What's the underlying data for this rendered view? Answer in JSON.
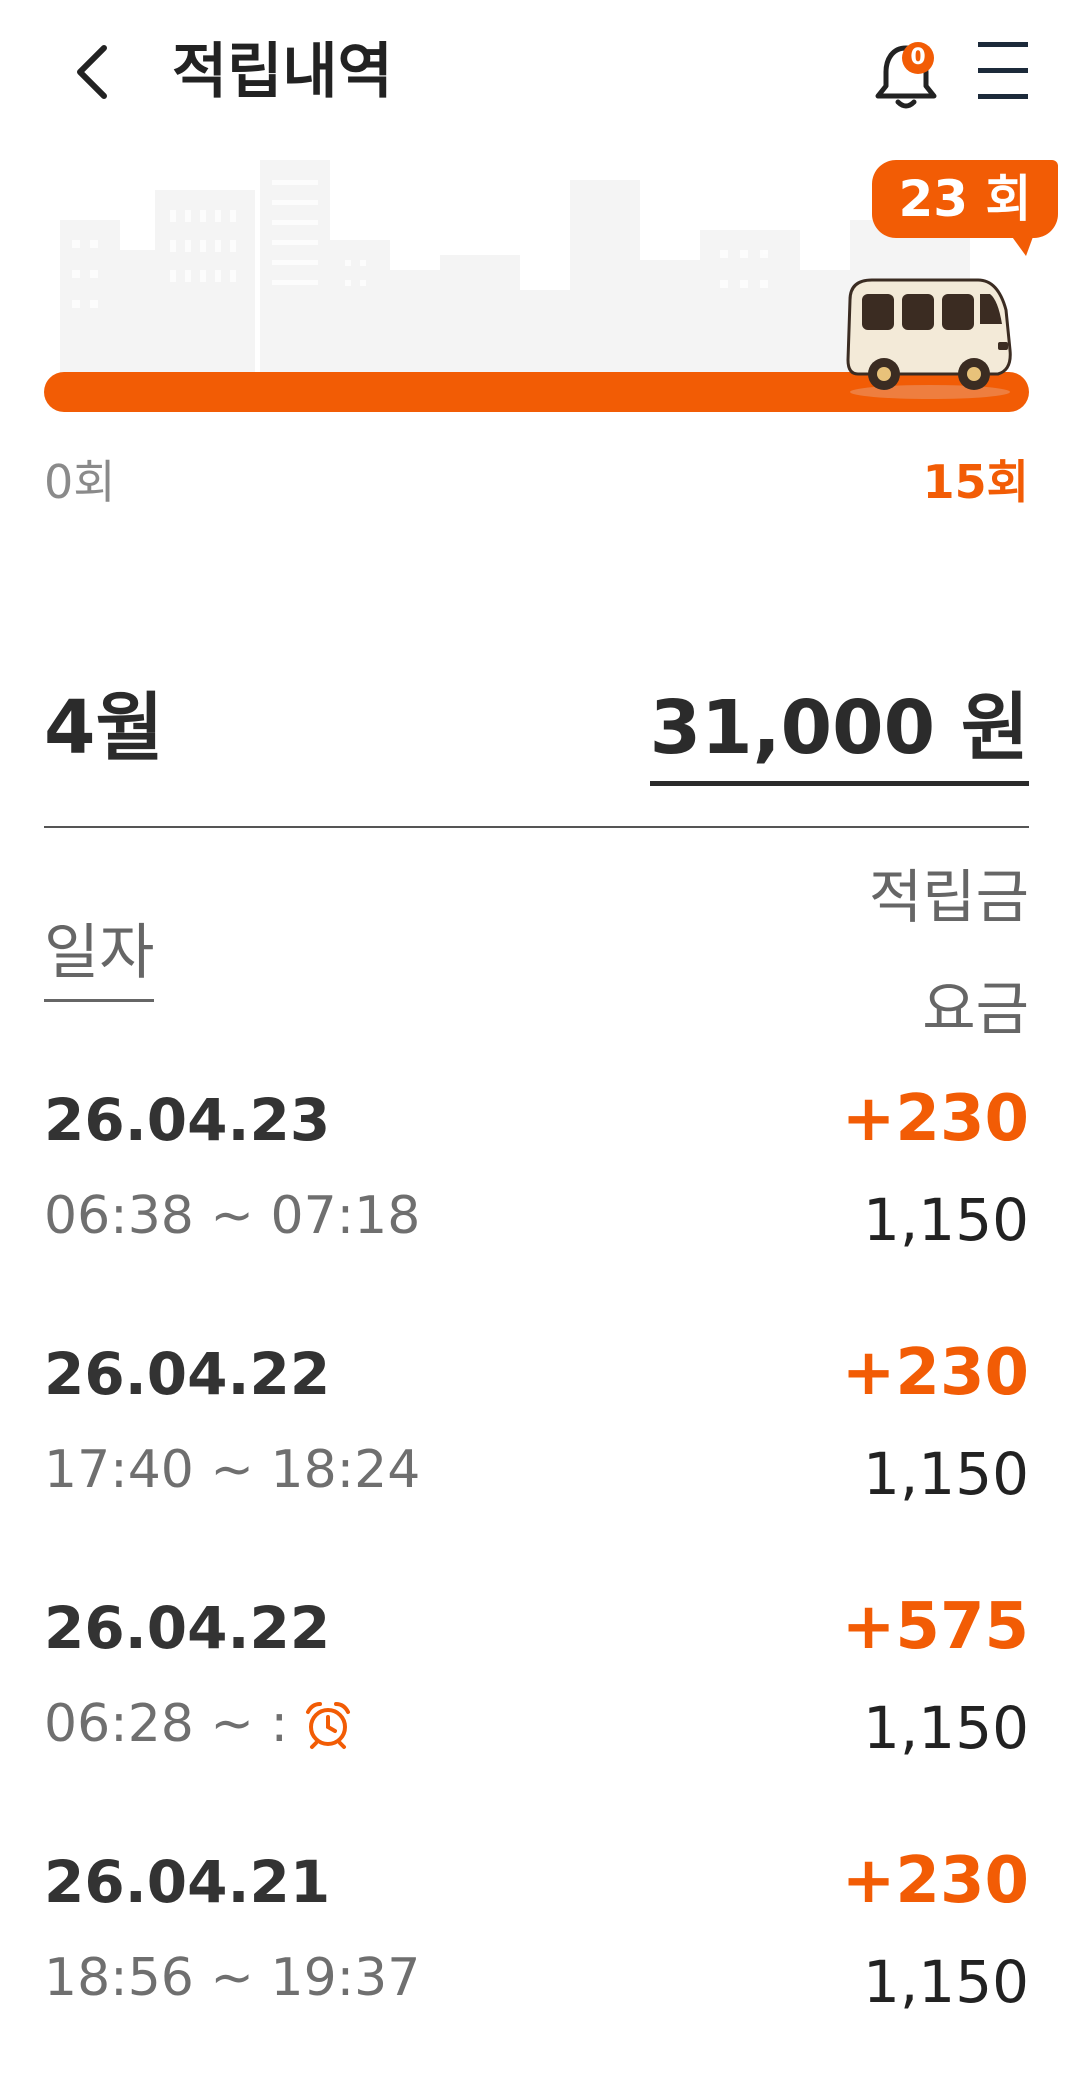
{
  "header": {
    "title": "적립내역",
    "back_icon": "chevron-left-icon",
    "bell_icon": "bell-icon",
    "bell_badge": "0",
    "menu_icon": "hamburger-menu-icon"
  },
  "progress": {
    "count_label": "23 회",
    "scale_min": "0회",
    "scale_max": "15회",
    "fill_fraction": 1.0,
    "accent_color": "#f25c05"
  },
  "summary": {
    "month": "4월",
    "total": "31,000 원"
  },
  "columns": {
    "date": "일자",
    "points": "적립금",
    "fare": "요금"
  },
  "rows": [
    {
      "date": "26.04.23",
      "time": "06:38 ~ 07:18",
      "points": "+230",
      "fare": "1,150",
      "alarm": false
    },
    {
      "date": "26.04.22",
      "time": "17:40 ~ 18:24",
      "points": "+230",
      "fare": "1,150",
      "alarm": false
    },
    {
      "date": "26.04.22",
      "time": "06:28 ~ :",
      "points": "+575",
      "fare": "1,150",
      "alarm": true
    },
    {
      "date": "26.04.21",
      "time": "18:56 ~ 19:37",
      "points": "+230",
      "fare": "1,150",
      "alarm": false
    }
  ]
}
